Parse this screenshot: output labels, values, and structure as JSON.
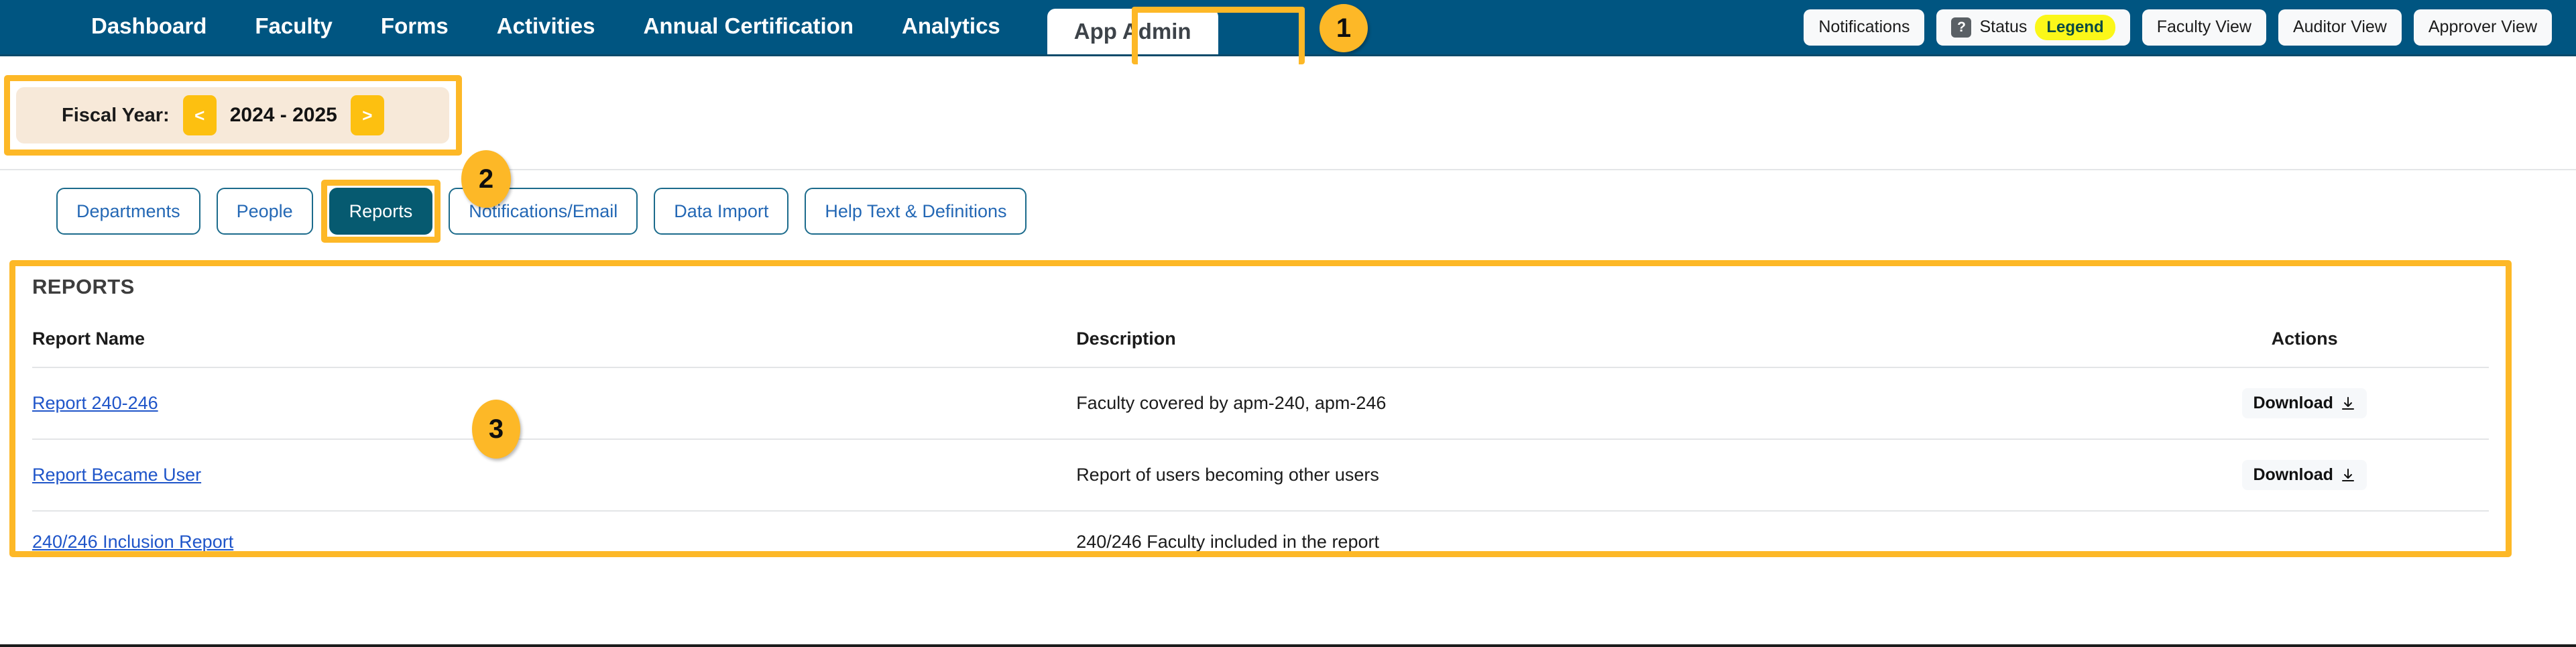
{
  "colors": {
    "nav_bg": "#005581",
    "highlight_gold": "#FDB827",
    "active_tab_teal": "#065A70",
    "fiscal_panel_bg": "#F7E9D9",
    "link_blue": "#1F55C9",
    "legend_yellow": "#FBF719"
  },
  "topnav": {
    "items": [
      {
        "label": "Dashboard",
        "active": false
      },
      {
        "label": "Faculty",
        "active": false
      },
      {
        "label": "Forms",
        "active": false
      },
      {
        "label": "Activities",
        "active": false
      },
      {
        "label": "Annual Certification",
        "active": false
      },
      {
        "label": "Analytics",
        "active": false
      }
    ],
    "active_tab": "App Admin",
    "right_buttons": [
      {
        "label": "Notifications"
      },
      {
        "label": "Faculty View"
      },
      {
        "label": "Auditor View"
      },
      {
        "label": "Approver View"
      }
    ],
    "status_button": {
      "icon": "question-mark-icon",
      "label": "Status",
      "badge": "Legend"
    }
  },
  "callouts": [
    {
      "number": "1"
    },
    {
      "number": "2"
    },
    {
      "number": "3"
    }
  ],
  "fiscal_year": {
    "label": "Fiscal Year:",
    "prev_arrow": "<",
    "value": "2024 - 2025",
    "next_arrow": ">"
  },
  "subtabs": [
    {
      "label": "Departments",
      "active": false
    },
    {
      "label": "People",
      "active": false
    },
    {
      "label": "Reports",
      "active": true
    },
    {
      "label": "Notifications/Email",
      "active": false
    },
    {
      "label": "Data Import",
      "active": false
    },
    {
      "label": "Help Text & Definitions",
      "active": false
    }
  ],
  "reports_panel": {
    "title": "REPORTS",
    "columns": {
      "name": "Report Name",
      "description": "Description",
      "actions": "Actions"
    },
    "download_label": "Download",
    "rows": [
      {
        "name": "Report 240-246",
        "description": "Faculty covered by apm-240, apm-246",
        "has_download": true
      },
      {
        "name": "Report Became User",
        "description": "Report of users becoming other users",
        "has_download": true
      },
      {
        "name": "240/246 Inclusion Report",
        "description": "240/246 Faculty included in the report",
        "has_download": false
      }
    ]
  }
}
